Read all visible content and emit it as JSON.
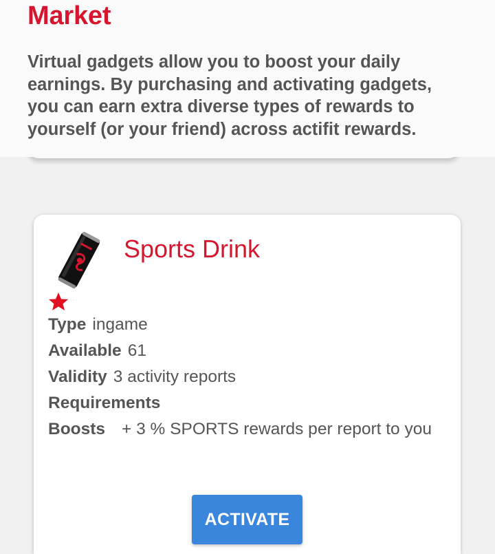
{
  "market": {
    "title": "Market",
    "description": "Virtual gadgets allow you to boost your daily earnings. By purchasing and activating gadgets, you can earn extra diverse types of rewards to yourself (or your friend) across actifit rewards."
  },
  "gadget": {
    "name": "Sports Drink",
    "icon": "energy-drink-can",
    "rating_icon": "star",
    "type_label": "Type",
    "type_value": "ingame",
    "available_label": "Available",
    "available_value": "61",
    "validity_label": "Validity",
    "validity_value": "3 activity reports",
    "requirements_label": "Requirements",
    "boosts_label": "Boosts",
    "boosts_value": "+ 3 % SPORTS rewards per report to you",
    "activate_label": "ACTIVATE"
  },
  "colors": {
    "accent_red": "#d6162e",
    "button_blue": "#3a86dd",
    "text_gray": "#555555"
  }
}
